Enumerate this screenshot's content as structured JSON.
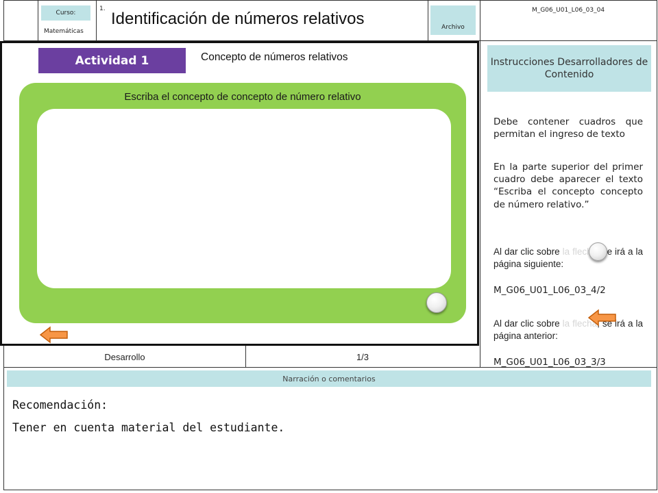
{
  "header": {
    "course_label": "Curso:",
    "course_name": "Matemáticas",
    "number": "1.",
    "title": "Identificación de números relativos",
    "file_label": "Archivo",
    "code": "M_G06_U01_L06_03_04"
  },
  "activity": {
    "badge": "Actividad 1",
    "concept_title": "Concepto de números relativos",
    "prompt": "Escriba  el concepto de concepto de número relativo",
    "answer_value": ""
  },
  "footer_row": {
    "section": "Desarrollo",
    "page": "1/3"
  },
  "instructions": {
    "header": "Instrucciones Desarrolladores de Contenido",
    "p1": "Debe contener cuadros que permitan el ingreso de texto",
    "p2": "En la parte superior del primer cuadro debe aparecer el texto “Escriba el concepto concepto de número relativo.”",
    "p3_a": "Al dar clic sobre",
    "p3_b": "la flecha",
    "p3_c": ", se irá a la página siguiente:",
    "p3_code": "M_G06_U01_L06_03_4/2",
    "p4_a": "Al dar clic sobre",
    "p4_b": "la flecha",
    "p4_c": ", se irá a la página anterior:",
    "p4_code": "M_G06_U01_L06_03_3/3"
  },
  "narration": {
    "header": "Narración o comentarios",
    "line1": "Recomendación:",
    "line2": "Tener en cuenta material del estudiante."
  },
  "colors": {
    "activity_purple": "#6b3fa0",
    "panel_green": "#92d050",
    "header_teal": "#bfe3e6",
    "arrow_orange": "#f79646"
  },
  "icons": {
    "next": "round-next-button-icon",
    "back": "left-arrow-icon"
  }
}
